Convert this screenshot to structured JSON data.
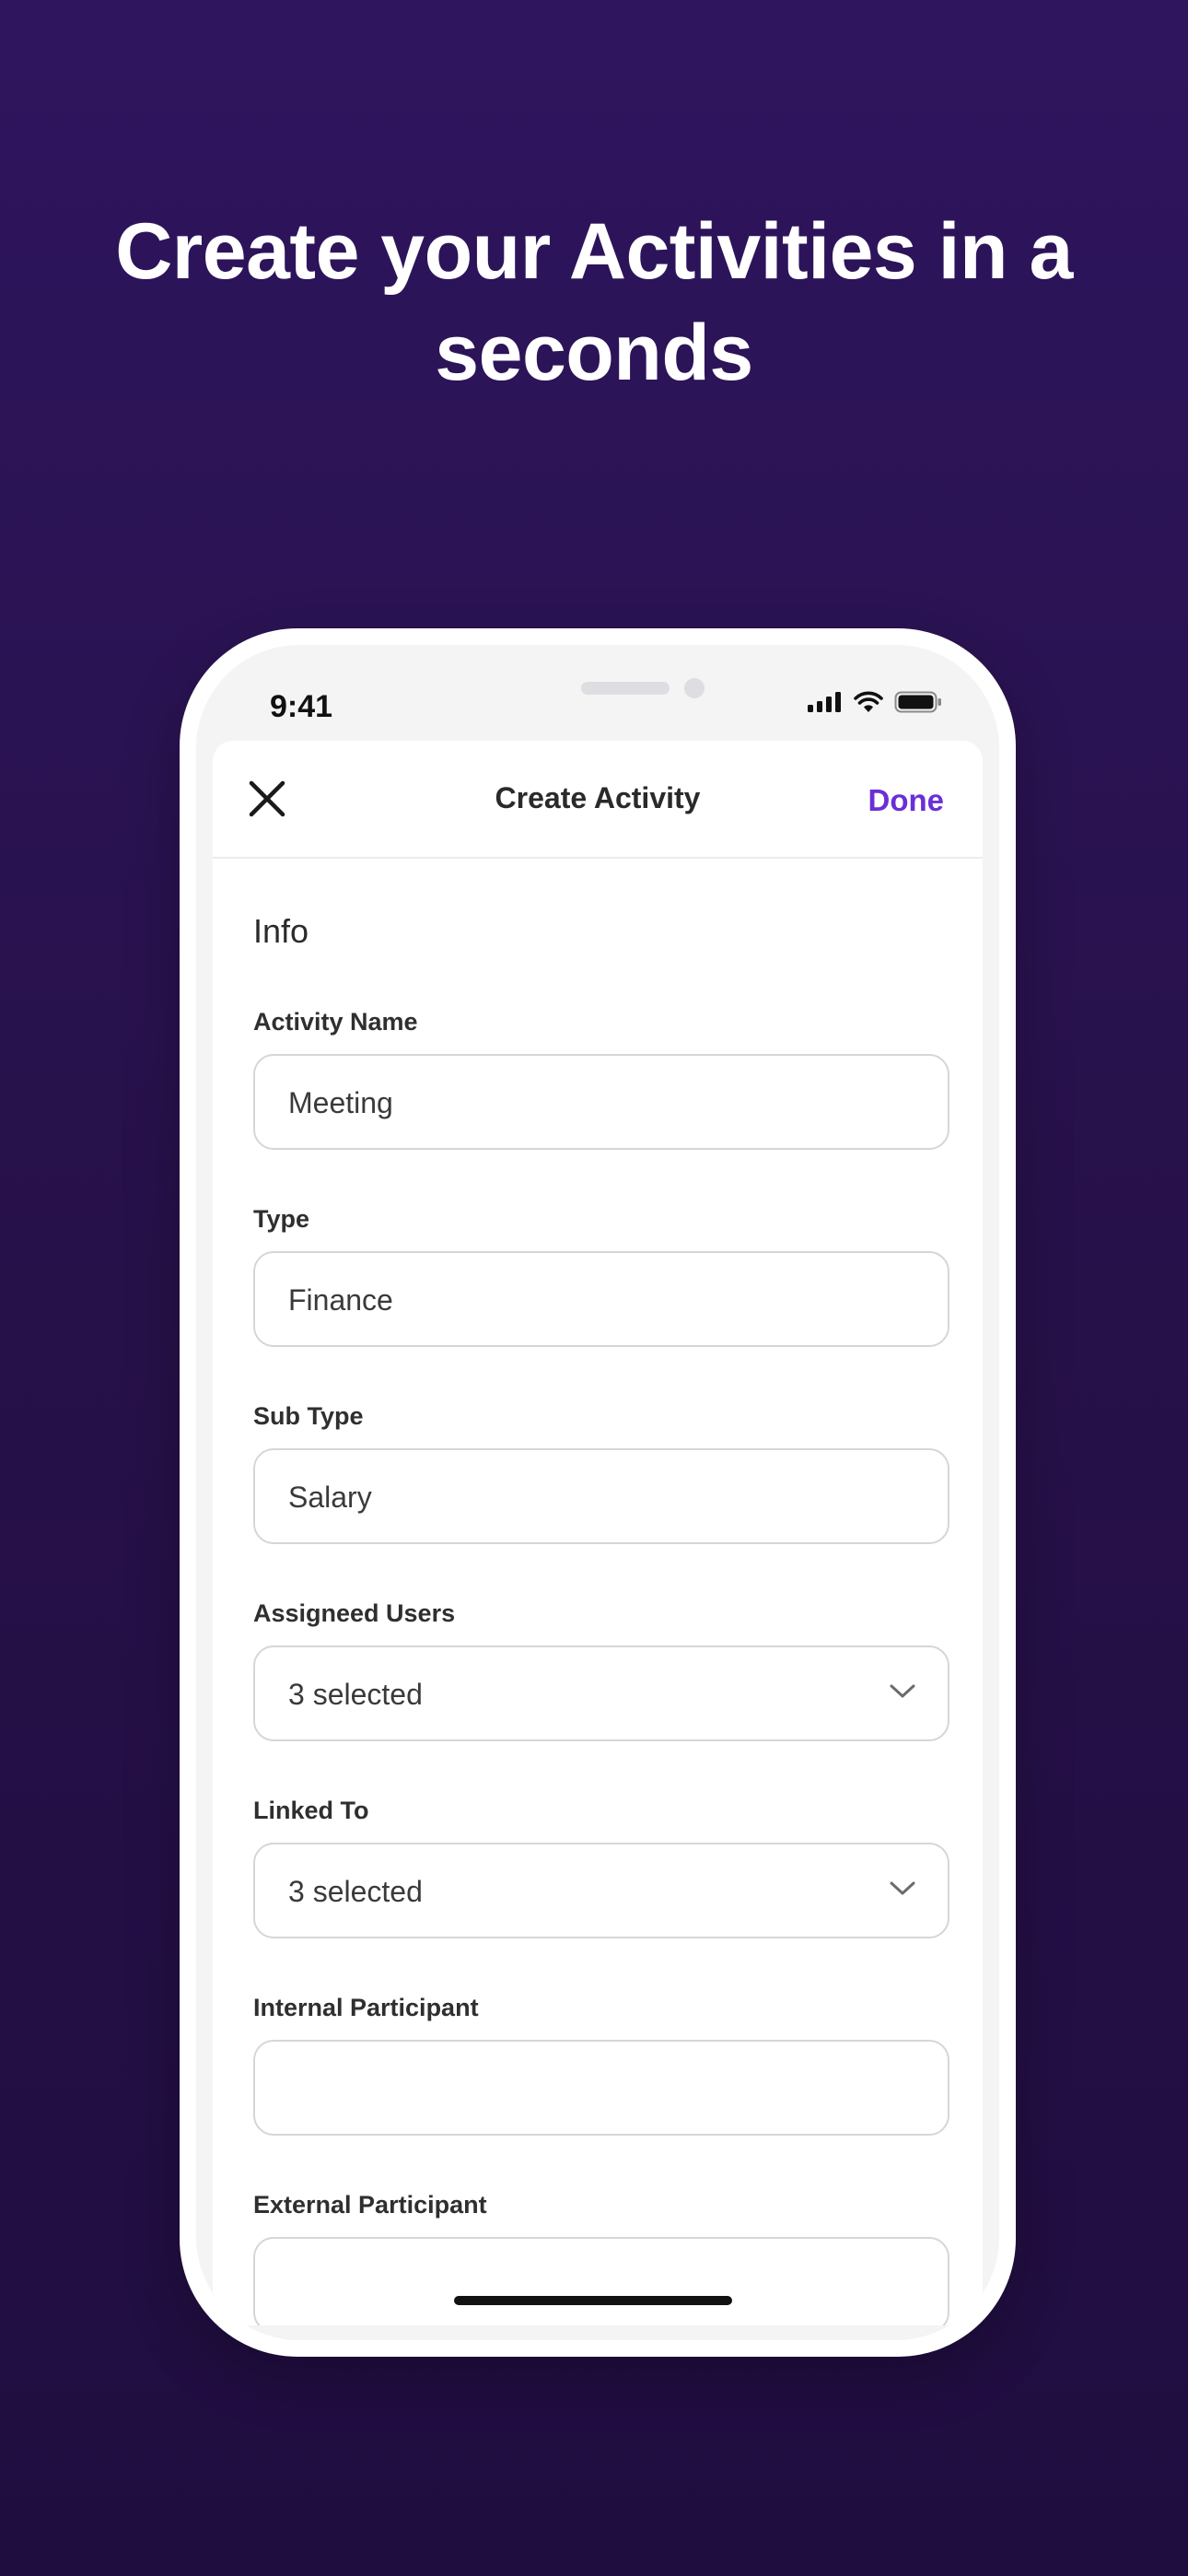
{
  "headline": {
    "line1": "Create your Activities in a",
    "line2": "seconds"
  },
  "status_bar": {
    "time": "9:41",
    "icons": [
      "signal-icon",
      "wifi-icon",
      "battery-icon"
    ]
  },
  "nav": {
    "close_icon": "close-icon",
    "title": "Create Activity",
    "done_label": "Done"
  },
  "form": {
    "section_title": "Info",
    "fields": [
      {
        "label": "Activity Name",
        "value": "Meeting",
        "type": "text"
      },
      {
        "label": "Type",
        "value": "Finance",
        "type": "text"
      },
      {
        "label": "Sub Type",
        "value": "Salary",
        "type": "text"
      },
      {
        "label": "Assigneed Users",
        "value": "3 selected",
        "type": "select",
        "icon": "chevron-down-icon"
      },
      {
        "label": "Linked To",
        "value": "3 selected",
        "type": "select",
        "icon": "chevron-down-icon"
      },
      {
        "label": "Internal Participant",
        "value": "",
        "type": "text"
      },
      {
        "label": "External Participant",
        "value": "",
        "type": "text"
      }
    ]
  },
  "colors": {
    "background": "#2a1354",
    "accent": "#6a2fd6",
    "text_dark": "#2a2a2a",
    "border": "#d6d6d8"
  }
}
